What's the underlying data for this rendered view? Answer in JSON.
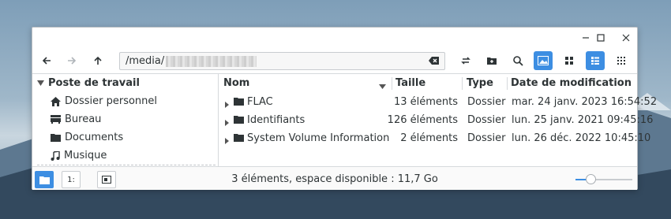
{
  "colors": {
    "accent": "#3d8ee2",
    "window_bg": "#ffffff",
    "text": "#2e3436"
  },
  "window_controls": {
    "minimize": "minimize-icon",
    "maximize": "maximize-icon",
    "close": "close-icon"
  },
  "toolbar": {
    "back_icon": "arrow-left-icon",
    "forward_icon": "arrow-right-icon",
    "up_icon": "arrow-up-icon",
    "path_value": "/media/",
    "clear_icon": "backspace-icon",
    "reload_icon": "reload-icon",
    "new_folder_icon": "new-folder-icon",
    "search_icon": "search-icon",
    "thumbnails_icon": "image-icon",
    "grid_icon": "grid-icon",
    "list_icon": "list-icon",
    "compact_icon": "compact-grid-icon"
  },
  "sidebar": {
    "section": "Poste de travail",
    "items": [
      {
        "label": "Dossier personnel",
        "icon": "home-icon"
      },
      {
        "label": "Bureau",
        "icon": "desktop-icon"
      },
      {
        "label": "Documents",
        "icon": "folder-icon"
      },
      {
        "label": "Musique",
        "icon": "music-icon"
      }
    ]
  },
  "columns": {
    "name": "Nom",
    "size": "Taille",
    "type": "Type",
    "modified": "Date de modification"
  },
  "files": [
    {
      "name": "FLAC",
      "size": "13 éléments",
      "type": "Dossier",
      "modified": "mar. 24 janv. 2023 16:54:52"
    },
    {
      "name": "Identifiants",
      "size": "126 éléments",
      "type": "Dossier",
      "modified": "lun. 25 janv. 2021 09:45:16"
    },
    {
      "name": "System Volume Information",
      "size": "2 éléments",
      "type": "Dossier",
      "modified": "lun. 26 déc. 2022 10:45:10"
    }
  ],
  "statusbar": {
    "places_icon": "folder-icon",
    "tree_label": "1:",
    "hide_sidebar_icon": "sidebar-icon",
    "status": "3 éléments, espace disponible : 11,7 Go",
    "zoom_level": 0.22
  }
}
